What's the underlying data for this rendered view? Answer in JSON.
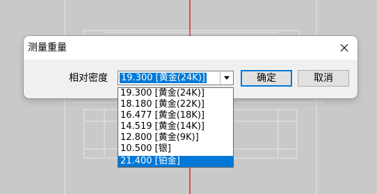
{
  "dialog": {
    "title": "测量重量",
    "density_label": "相对密度",
    "combo_value": "19.300  [黄金(24K)]",
    "ok_label": "确定",
    "cancel_label": "取消"
  },
  "dropdown": {
    "items": [
      "19.300  [黄金(24K)]",
      "18.180  [黄金(22K)]",
      "16.477  [黄金(18K)]",
      "14.519  [黄金(14K)]",
      "12.800  [黄金(9K)]",
      "10.500  [银]",
      "21.400  [铂金]"
    ],
    "highlighted_index": 6
  },
  "colors": {
    "accent": "#0078d7",
    "viewport_axis": "#e00000",
    "viewport_bg": "#c9c9c9"
  }
}
